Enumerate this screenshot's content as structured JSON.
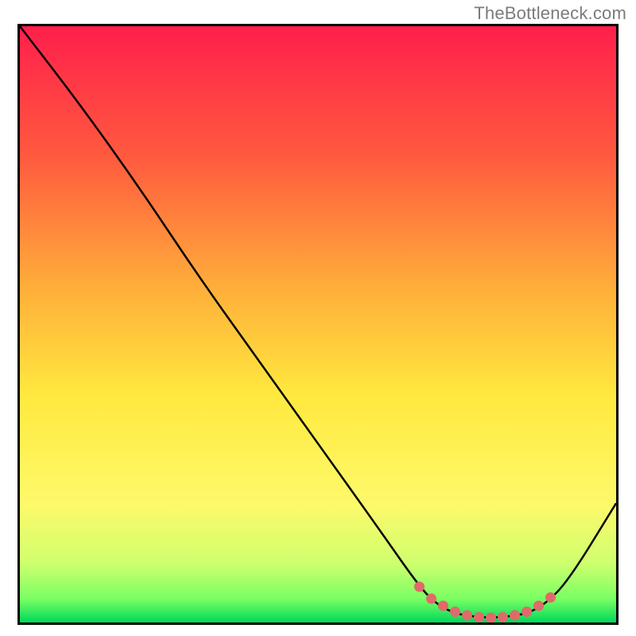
{
  "watermark": "TheBottleneck.com",
  "chart_data": {
    "type": "line",
    "title": "",
    "xlabel": "",
    "ylabel": "",
    "xlim": [
      0,
      100
    ],
    "ylim": [
      0,
      100
    ],
    "grid": false,
    "series": [
      {
        "name": "curve",
        "x": [
          0,
          10,
          20,
          30,
          40,
          50,
          60,
          67,
          70,
          73,
          76,
          79,
          82,
          85,
          88,
          92,
          100
        ],
        "values": [
          100,
          87,
          73,
          58,
          44,
          30,
          16,
          6,
          3,
          1.5,
          1,
          0.8,
          1,
          1.5,
          3,
          7,
          20
        ]
      },
      {
        "name": "markers",
        "x": [
          67,
          69,
          71,
          73,
          75,
          77,
          79,
          81,
          83,
          85,
          87,
          89
        ],
        "values": [
          6.0,
          4.0,
          2.8,
          1.8,
          1.2,
          0.9,
          0.8,
          0.9,
          1.2,
          1.8,
          2.8,
          4.2
        ]
      }
    ],
    "colors": {
      "curve": "#000000",
      "markers": "#e06a6a",
      "gradient_top": "#ff1f4b",
      "gradient_upper_mid": "#ff8a3a",
      "gradient_mid": "#ffd23a",
      "gradient_lower_mid": "#fef96a",
      "gradient_low": "#d6ff6e",
      "gradient_bottom": "#00d85a"
    },
    "background": {
      "type": "vertical-gradient",
      "stops": [
        {
          "offset": 0.0,
          "color": "#ff1f4b"
        },
        {
          "offset": 0.22,
          "color": "#ff5a3e"
        },
        {
          "offset": 0.45,
          "color": "#ffb23a"
        },
        {
          "offset": 0.62,
          "color": "#ffe93f"
        },
        {
          "offset": 0.8,
          "color": "#fef96a"
        },
        {
          "offset": 0.9,
          "color": "#cfff6e"
        },
        {
          "offset": 0.96,
          "color": "#7bff63"
        },
        {
          "offset": 1.0,
          "color": "#00d85a"
        }
      ]
    }
  }
}
